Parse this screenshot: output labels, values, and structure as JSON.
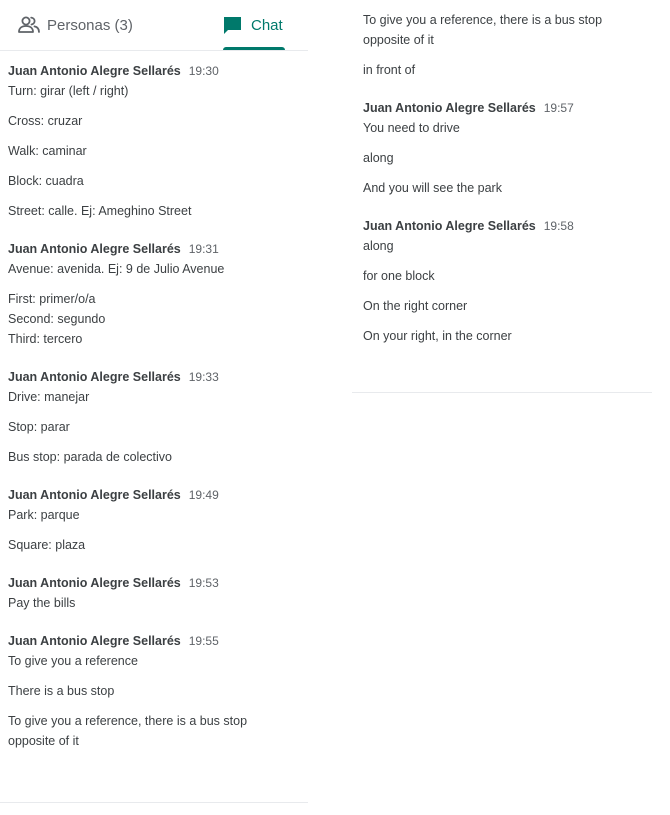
{
  "tabs": {
    "people_label": "Personas (3)",
    "chat_label": "Chat",
    "people_icon": "people-icon",
    "chat_icon": "chat-bubble-icon",
    "active_color": "#00796b"
  },
  "left_panel": {
    "groups": [
      {
        "sender": "Juan Antonio Alegre Sellarés",
        "time": "19:30",
        "messages": [
          "Turn: girar (left / right)",
          "Cross: cruzar",
          "Walk: caminar",
          "Block: cuadra",
          "Street: calle. Ej: Ameghino Street"
        ]
      },
      {
        "sender": "Juan Antonio Alegre Sellarés",
        "time": "19:31",
        "messages": [
          "Avenue: avenida. Ej: 9 de Julio Avenue",
          "First: primer/o/a\nSecond: segundo\nThird: tercero"
        ]
      },
      {
        "sender": "Juan Antonio Alegre Sellarés",
        "time": "19:33",
        "messages": [
          "Drive: manejar",
          "Stop: parar",
          "Bus stop: parada de colectivo"
        ]
      },
      {
        "sender": "Juan Antonio Alegre Sellarés",
        "time": "19:49",
        "messages": [
          "Park: parque",
          "Square: plaza"
        ]
      },
      {
        "sender": "Juan Antonio Alegre Sellarés",
        "time": "19:53",
        "messages": [
          "Pay the bills"
        ]
      },
      {
        "sender": "Juan Antonio Alegre Sellarés",
        "time": "19:55",
        "messages": [
          "To give you a reference",
          "There is a bus stop",
          "To give you a reference, there is a bus stop\nopposite of it"
        ]
      }
    ]
  },
  "right_panel": {
    "continuation_messages": [
      "To give you a reference, there is a bus stop\nopposite of it",
      "in front of"
    ],
    "groups": [
      {
        "sender": "Juan Antonio Alegre Sellarés",
        "time": "19:57",
        "messages": [
          "You need to drive",
          "along",
          "And you will see the park"
        ]
      },
      {
        "sender": "Juan Antonio Alegre Sellarés",
        "time": "19:58",
        "messages": [
          "along",
          "for one block",
          "On the right corner",
          "On your right, in the corner"
        ]
      }
    ]
  }
}
